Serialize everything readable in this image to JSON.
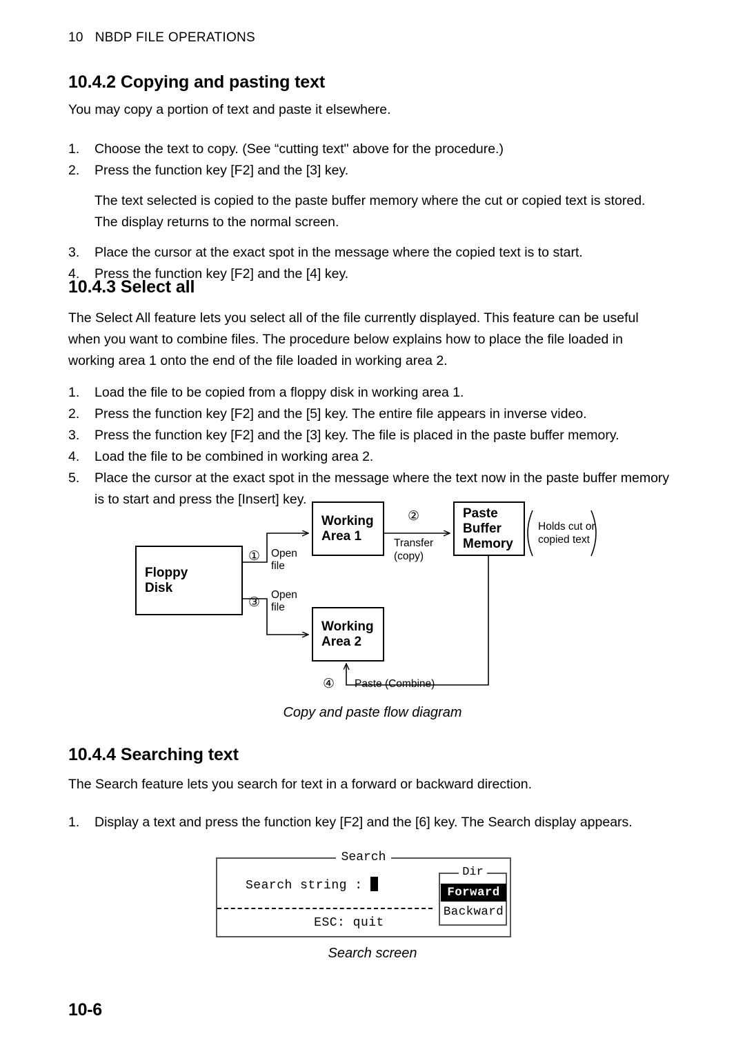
{
  "header": {
    "chapter_number": "10",
    "chapter_title": "NBDP FILE OPERATIONS"
  },
  "sections": {
    "copying": {
      "number": "10.4.2",
      "title": "Copying and pasting text",
      "intro": "You may copy a portion of text and paste it elsewhere.",
      "steps": [
        {
          "marker": "1.",
          "text": "Choose the text to copy. (See “cutting text\" above for the procedure.)"
        },
        {
          "marker": "2.",
          "text": "Press the function key [F2] and the [3] key."
        },
        {
          "marker": "3.",
          "text": "Place the cursor at the exact spot in the message where the copied text is to start."
        },
        {
          "marker": "4.",
          "text": "Press the function key [F2] and the [4] key."
        }
      ],
      "note_line1": "The text selected is copied to the paste buffer memory where the cut or copied text is stored.",
      "note_line2": "The display returns to the normal screen."
    },
    "select_all": {
      "number": "10.4.3",
      "title": "Select all",
      "intro": "The Select All feature lets you select all of the file currently displayed. This feature can be useful when you want to combine files. The procedure below explains how to place the file loaded in working area 1 onto the end of the file loaded in working area 2.",
      "steps": [
        {
          "marker": "1.",
          "text": "Load the file to be copied from a floppy disk in working area 1."
        },
        {
          "marker": "2.",
          "text": "Press the function key [F2] and the [5] key. The entire file appears in inverse video."
        },
        {
          "marker": "3.",
          "text": "Press the function key [F2] and the [3] key. The file is placed in the paste buffer memory."
        },
        {
          "marker": "4.",
          "text": "Load the file to be combined in working area 2."
        },
        {
          "marker": "5.",
          "text": "Place the cursor at the exact spot in the message where the text now in the paste buffer memory is to start and press the [Insert] key."
        }
      ]
    },
    "searching": {
      "number": "10.4.4",
      "title": "Searching text",
      "intro": "The Search feature lets you search for text in a forward or backward direction.",
      "steps": [
        {
          "marker": "1.",
          "text": "Display a text and press the function key [F2] and the [6] key. The Search display appears."
        }
      ]
    }
  },
  "flow_diagram": {
    "caption": "Copy and paste flow diagram",
    "boxes": {
      "floppy_disk_line1": "Floppy",
      "floppy_disk_line2": "Disk",
      "working_area_1_line1": "Working",
      "working_area_1_line2": "Area 1",
      "working_area_2_line1": "Working",
      "working_area_2_line2": "Area 2",
      "paste_buffer_line1": "Paste",
      "paste_buffer_line2": "Buffer",
      "paste_buffer_line3": "Memory"
    },
    "annotations": {
      "step1_num": "①",
      "step1_label_line1": "Open",
      "step1_label_line2": "file",
      "step2_num": "②",
      "step2_label_line1": "Transfer",
      "step2_label_line2": "(copy)",
      "step3_num": "③",
      "step3_label_line1": "Open",
      "step3_label_line2": "file",
      "step4_num": "④",
      "step4_label": "Paste (Combine)",
      "buffer_note_line1": "Holds cut or",
      "buffer_note_line2": "copied text"
    }
  },
  "search_screen": {
    "caption": "Search screen",
    "title": "Search",
    "search_string_label": "Search string :",
    "search_string_value": "",
    "esc_hint": "ESC: quit",
    "dir": {
      "title": "Dir",
      "options": [
        {
          "label": "Forward",
          "selected": true
        },
        {
          "label": "Backward",
          "selected": false
        }
      ]
    }
  },
  "footer": {
    "page_number": "10-6"
  }
}
